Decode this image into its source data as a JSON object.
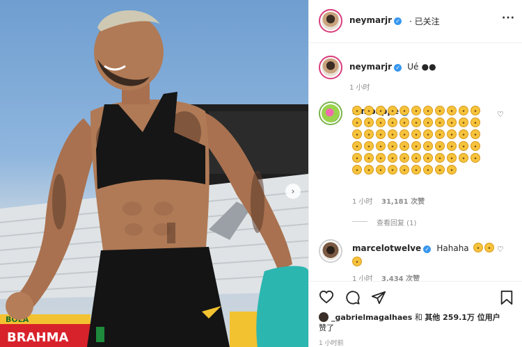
{
  "post": {
    "author": "neymarjr",
    "follow_status": "· 已关注",
    "more_icon": "more-horizontal-icon"
  },
  "photo": {
    "banner_text_left": "BRAHMA",
    "banner_text_left2": "BOLA",
    "colors": {
      "sky": "#8fb6de",
      "top": "#161616",
      "shorts": "#141414",
      "skin": "#b07a56"
    }
  },
  "caption": {
    "username": "neymarjr",
    "text": "Ué",
    "time": "1 小时"
  },
  "comments": [
    {
      "username": "k.mbappe",
      "emoji_count": 64,
      "time": "1 小时",
      "likes": "31,181 次赞",
      "view_replies": "查看回复 (1)"
    },
    {
      "username": "marcelotwelve",
      "text": "Hahaha",
      "time": "1 小时",
      "likes": "3,434 次赞"
    }
  ],
  "actions": {
    "liked_by_user": "_gabrielmagalhaes",
    "liked_by_sep": "和",
    "others_label": "其他 259.1万 位用户",
    "liked_suffix": "赞了",
    "time_ago": "1 小时前"
  }
}
